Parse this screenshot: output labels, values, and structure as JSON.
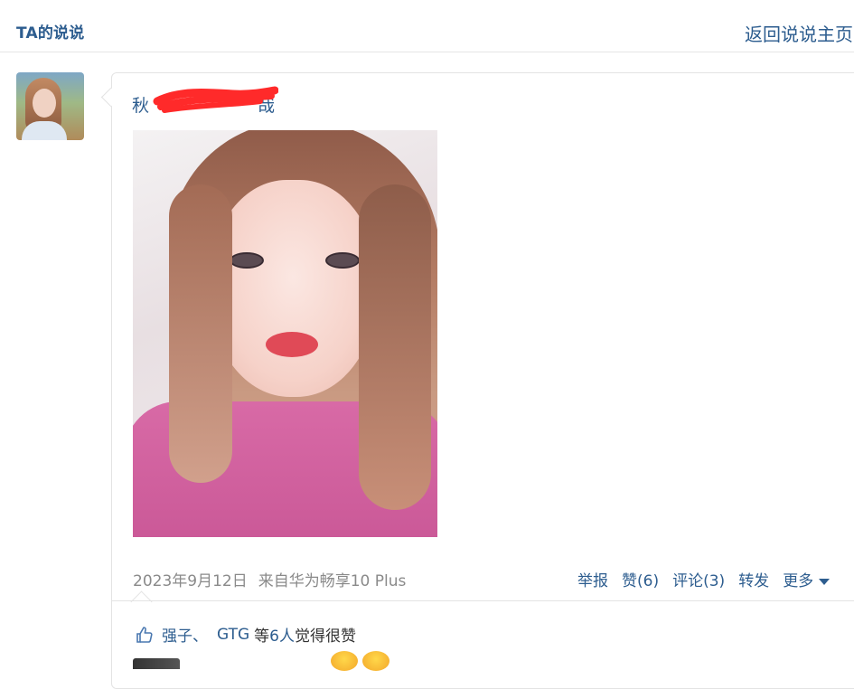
{
  "header": {
    "title": "TA的说说",
    "back_link": "返回说说主页"
  },
  "post": {
    "author_visible": "秋",
    "author_suffix": "哉",
    "date": "2023年9月12日",
    "source": "来自华为畅享10 Plus",
    "actions": {
      "report": "举报",
      "like": "赞(6)",
      "comment": "评论(3)",
      "forward": "转发",
      "more": "更多"
    },
    "likes": {
      "liker1": "强子、",
      "liker2": "GTG",
      "prefix": "等",
      "count": "6人",
      "suffix": "觉得很赞"
    }
  },
  "colors": {
    "link": "#2d5d8f",
    "meta_text": "#8a8a8a",
    "redaction": "#ff2a2a"
  },
  "icons": [
    "thumbs-up-icon",
    "caret-down-icon"
  ]
}
